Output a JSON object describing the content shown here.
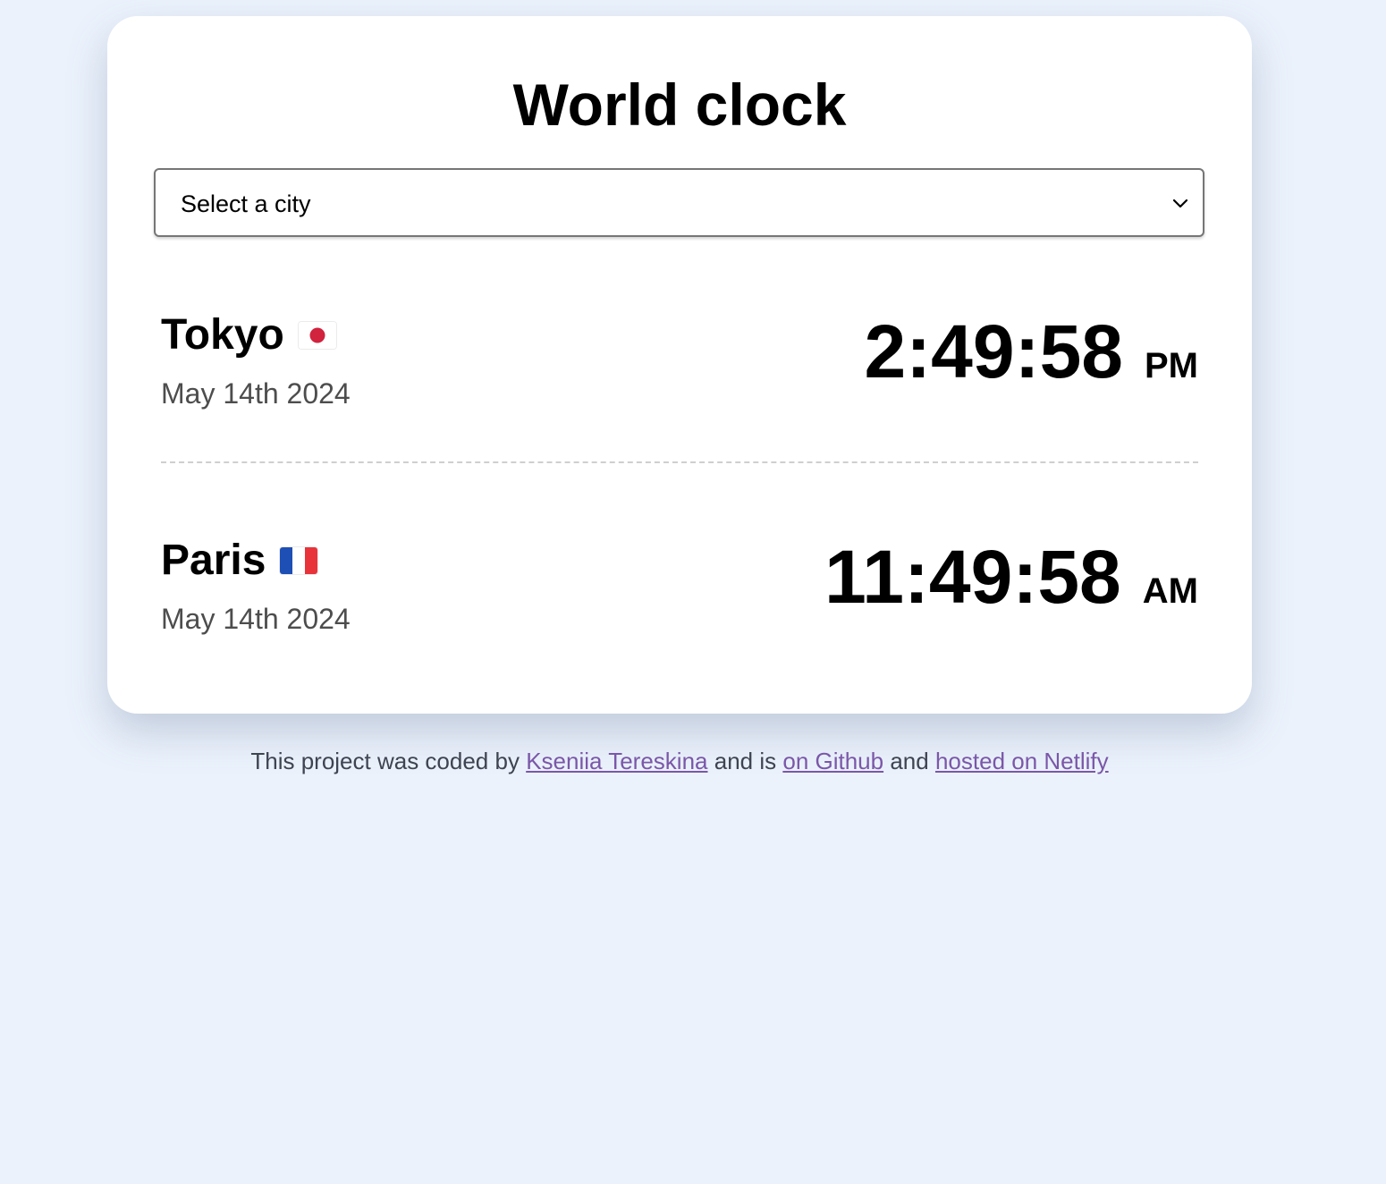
{
  "page": {
    "title": "World clock",
    "background_color": "#ebf2fc",
    "card_color": "#ffffff"
  },
  "city_select": {
    "selected_value": "Select a city",
    "icon": "chevron-down-icon"
  },
  "cities": [
    {
      "name": "Tokyo",
      "flag_icon": "japan-flag-icon",
      "date": "May 14th 2024",
      "time": "2:49:58",
      "period": "PM"
    },
    {
      "name": "Paris",
      "flag_icon": "france-flag-icon",
      "date": "May 14th 2024",
      "time": "11:49:58",
      "period": "AM"
    }
  ],
  "footer": {
    "text_1": "This project was coded by",
    "author_link": "Kseniia Tereskina",
    "text_2": "and is",
    "github_link": "on Github",
    "text_3": "and",
    "netlify_link": "hosted on Netlify",
    "link_color": "#7b57a8"
  }
}
